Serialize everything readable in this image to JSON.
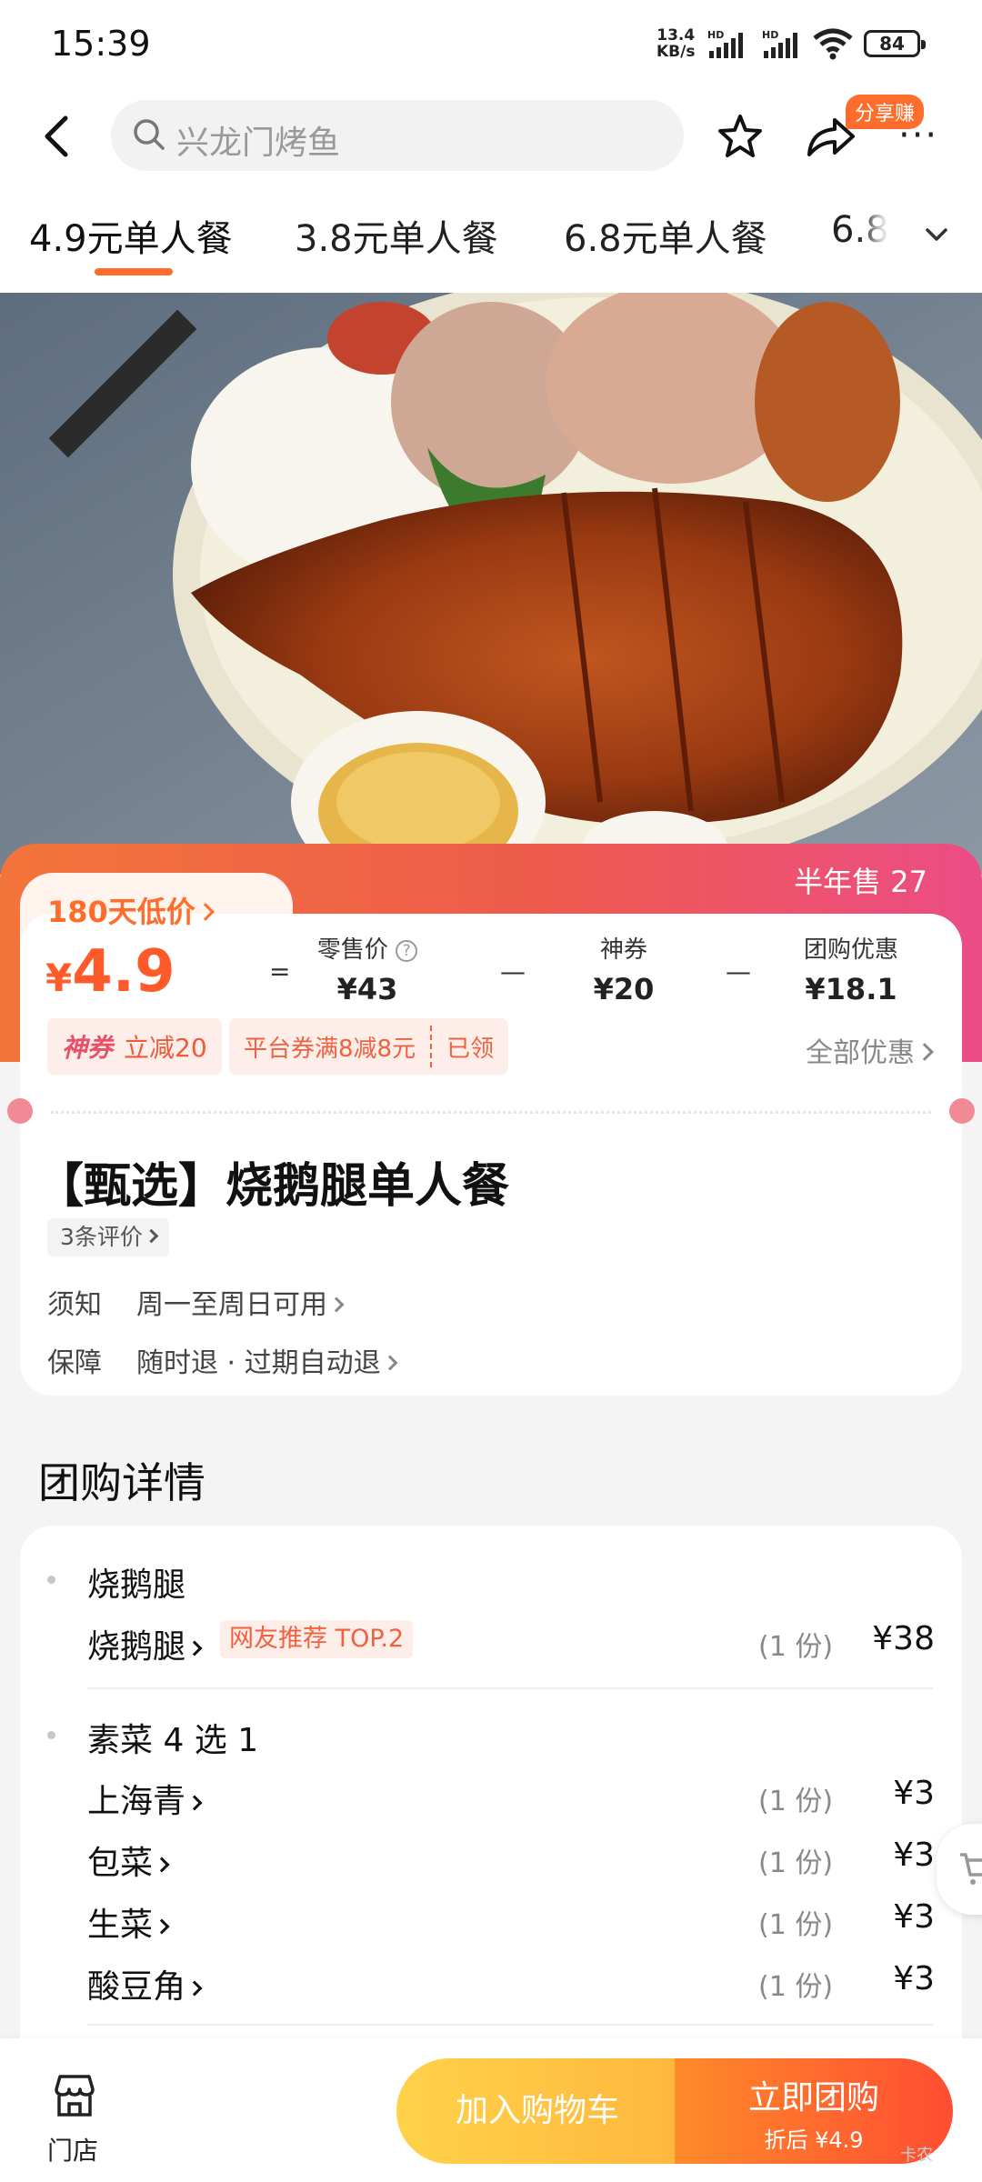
{
  "status_bar": {
    "time": "15:39",
    "net_speed_top": "13.4",
    "net_speed_bottom": "KB/s",
    "hd1": "HD",
    "hd2": "HD",
    "battery": "84"
  },
  "nav": {
    "search_placeholder": "兴龙门烤鱼",
    "share_badge": "分享赚",
    "more": "···"
  },
  "tabs": [
    "4.9元单人餐",
    "3.8元单人餐",
    "6.8元单人餐",
    "6.8"
  ],
  "banner": {
    "low_price_tag": "180天低价",
    "sold": "半年售 27",
    "currency": "¥",
    "price": "4.9",
    "equals": "=",
    "minus": "—",
    "retail_label": "零售价",
    "retail_value": "¥43",
    "help_mark": "?",
    "coupon_label": "神券",
    "coupon_value": "¥20",
    "group_label": "团购优惠",
    "group_value": "¥18.1",
    "god_coupon": "神券",
    "god_coupon_text": "立减20",
    "platform_coupon": "平台券满8减8元",
    "claimed": "已领",
    "all_promo": "全部优惠"
  },
  "deal": {
    "title": "【甄选】烧鹅腿单人餐",
    "reviews": "3条评价",
    "notice_label": "须知",
    "notice_value": "周一至周日可用",
    "guarantee_label": "保障",
    "guarantee_value": "随时退 · 过期自动退"
  },
  "details": {
    "section_title": "团购详情",
    "groups": [
      {
        "name": "烧鹅腿",
        "items": [
          {
            "name": "烧鹅腿",
            "tag": "网友推荐 TOP.2",
            "qty": "(1 份)",
            "price": "¥38"
          }
        ]
      },
      {
        "name": "素菜 4 选 1",
        "items": [
          {
            "name": "上海青",
            "qty": "(1 份)",
            "price": "¥3"
          },
          {
            "name": "包菜",
            "qty": "(1 份)",
            "price": "¥3"
          },
          {
            "name": "生菜",
            "qty": "(1 份)",
            "price": "¥3"
          },
          {
            "name": "酸豆角",
            "qty": "(1 份)",
            "price": "¥3"
          }
        ]
      }
    ]
  },
  "bottom_bar": {
    "store_label": "门店",
    "add_cart": "加入购物车",
    "buy_now": "立即团购",
    "buy_sub": "折后 ¥4.9",
    "watermark": "卡农"
  },
  "colors": {
    "accent": "#ff6d2d",
    "banner_start": "#f3743a",
    "banner_end": "#ec4c86",
    "cart_button": "#ffc845",
    "buy_button": "#ff5a30"
  }
}
